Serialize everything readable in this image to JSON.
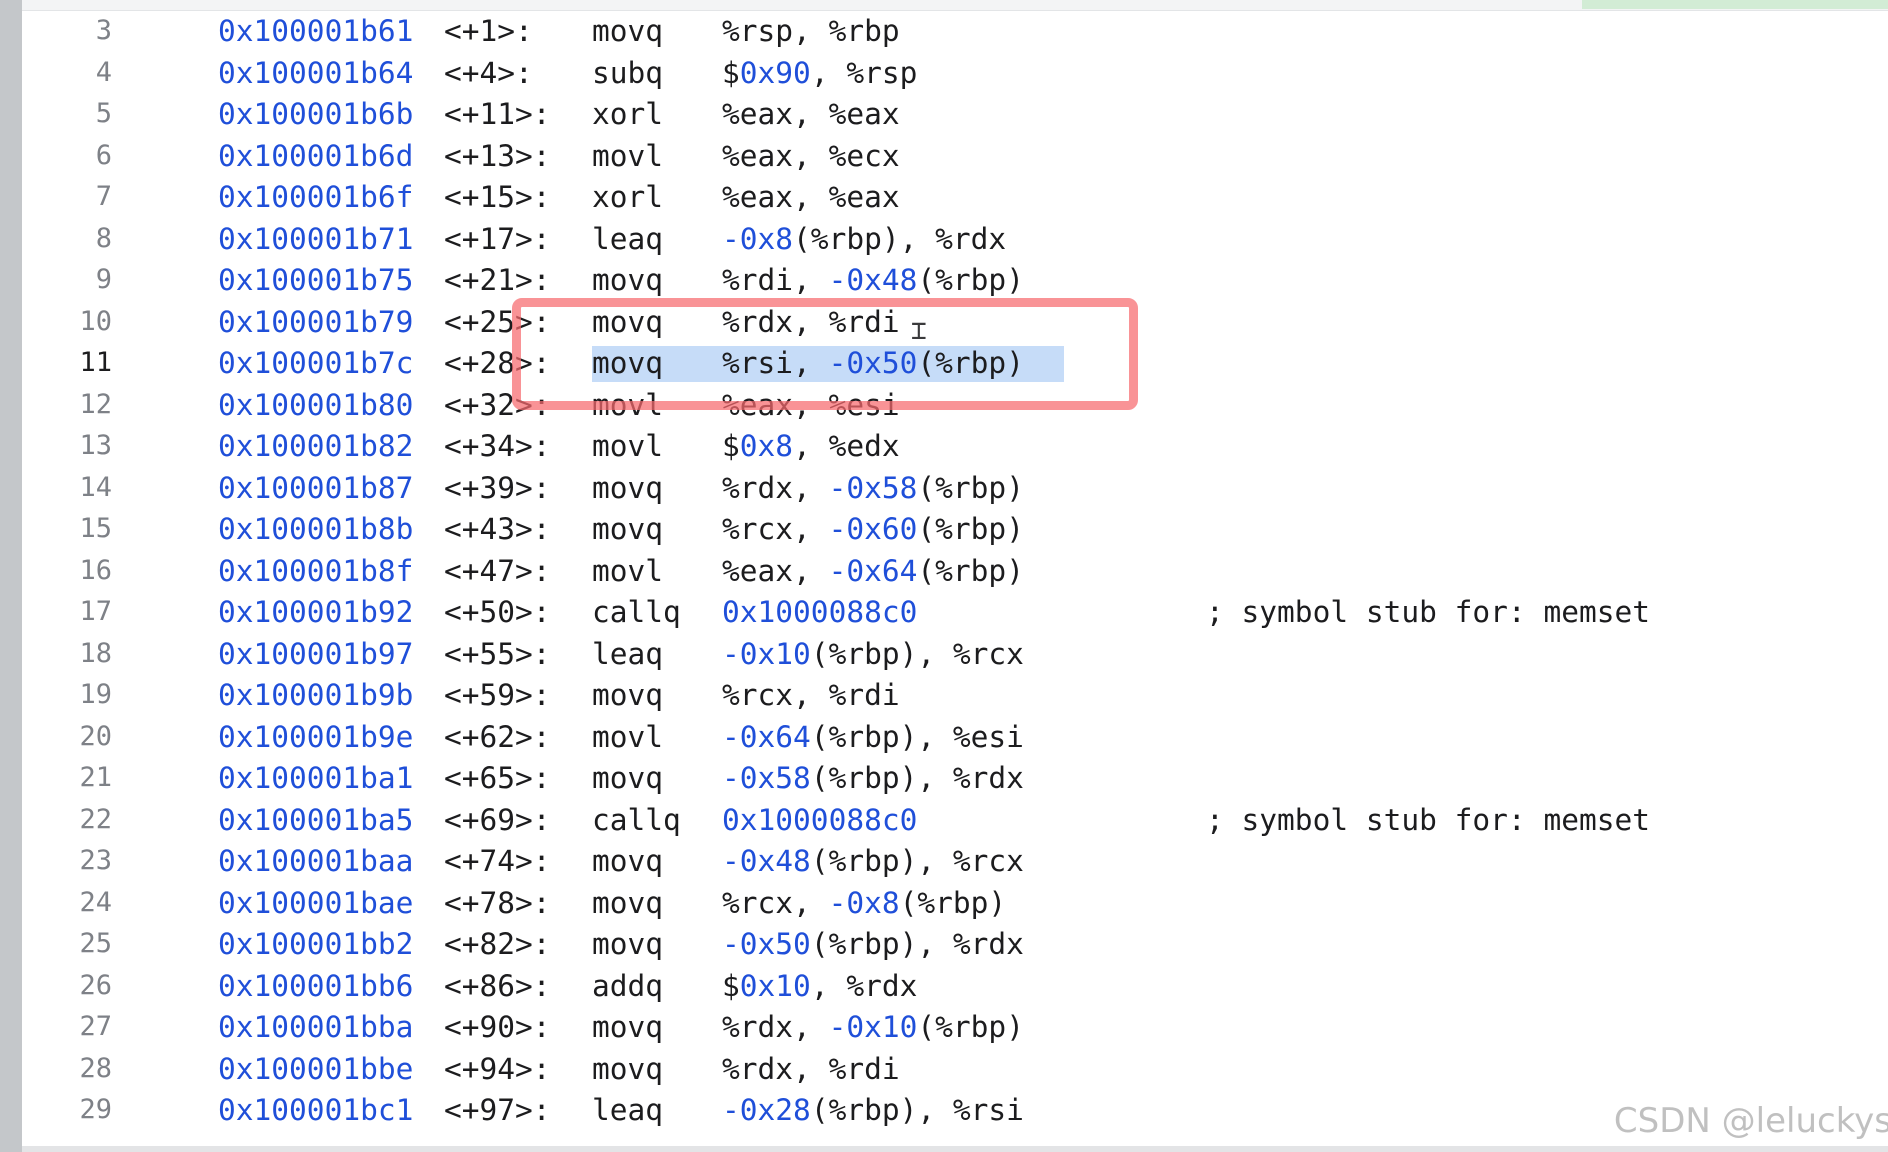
{
  "rows": [
    {
      "n": "3",
      "addr": "0x100001b61",
      "off": "<+1>:",
      "mn": "movq",
      "ops": [
        {
          "t": "%rsp, %rbp"
        }
      ],
      "cmt": ""
    },
    {
      "n": "4",
      "addr": "0x100001b64",
      "off": "<+4>:",
      "mn": "subq",
      "ops": [
        {
          "t": "$"
        },
        {
          "t": "0x90",
          "h": true
        },
        {
          "t": ", %rsp"
        }
      ],
      "cmt": ""
    },
    {
      "n": "5",
      "addr": "0x100001b6b",
      "off": "<+11>:",
      "mn": "xorl",
      "ops": [
        {
          "t": "%eax, %eax"
        }
      ],
      "cmt": ""
    },
    {
      "n": "6",
      "addr": "0x100001b6d",
      "off": "<+13>:",
      "mn": "movl",
      "ops": [
        {
          "t": "%eax, %ecx"
        }
      ],
      "cmt": ""
    },
    {
      "n": "7",
      "addr": "0x100001b6f",
      "off": "<+15>:",
      "mn": "xorl",
      "ops": [
        {
          "t": "%eax, %eax"
        }
      ],
      "cmt": ""
    },
    {
      "n": "8",
      "addr": "0x100001b71",
      "off": "<+17>:",
      "mn": "leaq",
      "ops": [
        {
          "t": "-0x8",
          "h": true
        },
        {
          "t": "(%rbp), %rdx"
        }
      ],
      "cmt": ""
    },
    {
      "n": "9",
      "addr": "0x100001b75",
      "off": "<+21>:",
      "mn": "movq",
      "ops": [
        {
          "t": "%rdi, "
        },
        {
          "t": "-0x48",
          "h": true
        },
        {
          "t": "(%rbp)"
        }
      ],
      "cmt": ""
    },
    {
      "n": "10",
      "addr": "0x100001b79",
      "off": "<+25>:",
      "mn": "movq",
      "ops": [
        {
          "t": "%rdx, %rdi"
        }
      ],
      "cmt": ""
    },
    {
      "n": "11",
      "addr": "0x100001b7c",
      "off": "<+28>:",
      "mn": "movq",
      "ops": [
        {
          "t": "%rsi, "
        },
        {
          "t": "-0x50",
          "h": true
        },
        {
          "t": "(%rbp)"
        }
      ],
      "cmt": "",
      "current": true
    },
    {
      "n": "12",
      "addr": "0x100001b80",
      "off": "<+32>:",
      "mn": "movl",
      "ops": [
        {
          "t": "%eax, %esi"
        }
      ],
      "cmt": ""
    },
    {
      "n": "13",
      "addr": "0x100001b82",
      "off": "<+34>:",
      "mn": "movl",
      "ops": [
        {
          "t": "$"
        },
        {
          "t": "0x8",
          "h": true
        },
        {
          "t": ", %edx"
        }
      ],
      "cmt": ""
    },
    {
      "n": "14",
      "addr": "0x100001b87",
      "off": "<+39>:",
      "mn": "movq",
      "ops": [
        {
          "t": "%rdx, "
        },
        {
          "t": "-0x58",
          "h": true
        },
        {
          "t": "(%rbp)"
        }
      ],
      "cmt": ""
    },
    {
      "n": "15",
      "addr": "0x100001b8b",
      "off": "<+43>:",
      "mn": "movq",
      "ops": [
        {
          "t": "%rcx, "
        },
        {
          "t": "-0x60",
          "h": true
        },
        {
          "t": "(%rbp)"
        }
      ],
      "cmt": ""
    },
    {
      "n": "16",
      "addr": "0x100001b8f",
      "off": "<+47>:",
      "mn": "movl",
      "ops": [
        {
          "t": "%eax, "
        },
        {
          "t": "-0x64",
          "h": true
        },
        {
          "t": "(%rbp)"
        }
      ],
      "cmt": ""
    },
    {
      "n": "17",
      "addr": "0x100001b92",
      "off": "<+50>:",
      "mn": "callq",
      "ops": [
        {
          "t": "0x1000088c0",
          "h": true
        }
      ],
      "cmt": "; symbol stub for: memset"
    },
    {
      "n": "18",
      "addr": "0x100001b97",
      "off": "<+55>:",
      "mn": "leaq",
      "ops": [
        {
          "t": "-0x10",
          "h": true
        },
        {
          "t": "(%rbp), %rcx"
        }
      ],
      "cmt": ""
    },
    {
      "n": "19",
      "addr": "0x100001b9b",
      "off": "<+59>:",
      "mn": "movq",
      "ops": [
        {
          "t": "%rcx, %rdi"
        }
      ],
      "cmt": ""
    },
    {
      "n": "20",
      "addr": "0x100001b9e",
      "off": "<+62>:",
      "mn": "movl",
      "ops": [
        {
          "t": "-0x64",
          "h": true
        },
        {
          "t": "(%rbp), %esi"
        }
      ],
      "cmt": ""
    },
    {
      "n": "21",
      "addr": "0x100001ba1",
      "off": "<+65>:",
      "mn": "movq",
      "ops": [
        {
          "t": "-0x58",
          "h": true
        },
        {
          "t": "(%rbp), %rdx"
        }
      ],
      "cmt": ""
    },
    {
      "n": "22",
      "addr": "0x100001ba5",
      "off": "<+69>:",
      "mn": "callq",
      "ops": [
        {
          "t": "0x1000088c0",
          "h": true
        }
      ],
      "cmt": "; symbol stub for: memset"
    },
    {
      "n": "23",
      "addr": "0x100001baa",
      "off": "<+74>:",
      "mn": "movq",
      "ops": [
        {
          "t": "-0x48",
          "h": true
        },
        {
          "t": "(%rbp), %rcx"
        }
      ],
      "cmt": ""
    },
    {
      "n": "24",
      "addr": "0x100001bae",
      "off": "<+78>:",
      "mn": "movq",
      "ops": [
        {
          "t": "%rcx, "
        },
        {
          "t": "-0x8",
          "h": true
        },
        {
          "t": "(%rbp)"
        }
      ],
      "cmt": ""
    },
    {
      "n": "25",
      "addr": "0x100001bb2",
      "off": "<+82>:",
      "mn": "movq",
      "ops": [
        {
          "t": "-0x50",
          "h": true
        },
        {
          "t": "(%rbp), %rdx"
        }
      ],
      "cmt": ""
    },
    {
      "n": "26",
      "addr": "0x100001bb6",
      "off": "<+86>:",
      "mn": "addq",
      "ops": [
        {
          "t": "$"
        },
        {
          "t": "0x10",
          "h": true
        },
        {
          "t": ", %rdx"
        }
      ],
      "cmt": ""
    },
    {
      "n": "27",
      "addr": "0x100001bba",
      "off": "<+90>:",
      "mn": "movq",
      "ops": [
        {
          "t": "%rdx, "
        },
        {
          "t": "-0x10",
          "h": true
        },
        {
          "t": "(%rbp)"
        }
      ],
      "cmt": ""
    },
    {
      "n": "28",
      "addr": "0x100001bbe",
      "off": "<+94>:",
      "mn": "movq",
      "ops": [
        {
          "t": "%rdx, %rdi"
        }
      ],
      "cmt": ""
    },
    {
      "n": "29",
      "addr": "0x100001bc1",
      "off": "<+97>:",
      "mn": "leaq",
      "ops": [
        {
          "t": "-0x28",
          "h": true
        },
        {
          "t": "(%rbp), %rsi"
        }
      ],
      "cmt": ""
    }
  ],
  "watermark": "CSDN @leluckys",
  "colors": {
    "address": "#1f4fd9",
    "hex_literal": "#1f4fd9",
    "text": "#1c1c1e",
    "line_number": "#7e8187",
    "selection": "#c6dcf8",
    "annotation_box": "#f6696e"
  }
}
